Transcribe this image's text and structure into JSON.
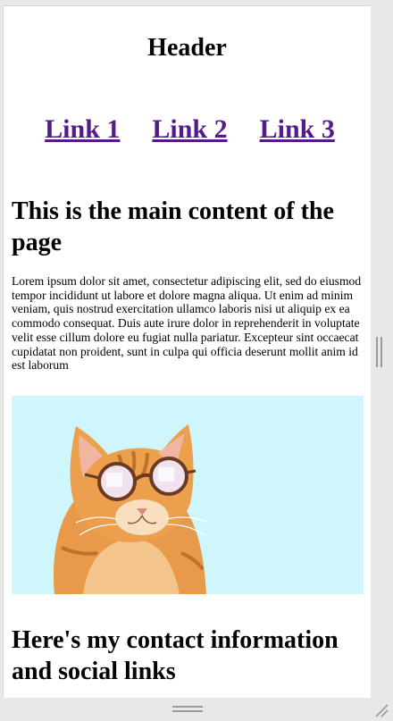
{
  "page": {
    "header_title": "Header",
    "nav_links": [
      "Link 1",
      "Link 2",
      "Link 3"
    ],
    "main_heading": "This is the main content of the page",
    "lorem_text": "Lorem ipsum dolor sit amet, consectetur adipiscing elit, sed do eiusmod tempor incididunt ut labore et dolore magna aliqua. Ut enim ad minim veniam, quis nostrud exercitation ullamco laboris nisi ut aliquip ex ea commodo consequat. Duis aute irure dolor in reprehenderit in voluptate velit esse cillum dolore eu fugiat nulla pariatur. Excepteur sint occaecat cupidatat non proident, sunt in culpa qui officia deserunt mollit anim id est laborum",
    "contact_heading": "Here's my contact information and social links"
  },
  "image": {
    "subject": "orange-cat-with-round-sunglasses",
    "background_color": "#cff6fc"
  },
  "colors": {
    "link": "#551a8b",
    "page_background": "#ffffff",
    "chrome_background": "#e8e8e8"
  },
  "icons": {
    "vertical_scroll_grip": "vertical-scroll-grip-icon",
    "horizontal_scroll_grip": "horizontal-scroll-grip-icon",
    "resize_handle": "resize-handle-icon"
  }
}
